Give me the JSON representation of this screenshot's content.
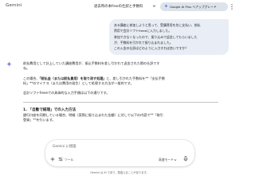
{
  "header": {
    "app_title": "Gemini",
    "chat_title": "退去時の本freeの仕訳と手数料",
    "plus_label": "Google AI Plus へアップグレード",
    "icons": {
      "chevron": "chevron-down-icon",
      "plus": "sparkle-icon",
      "menu": "more-vert-icon"
    }
  },
  "user_message": {
    "lines": [
      "ある講座に参加しようと思って、受講費用を先に支払い、前払",
      "費用で会計ソフトfreeeに入力しました。",
      "参加できなくなったので、振り込みで返金してもらいました",
      "が、手数料を引かれて振り込まれました。",
      "この入金の仕訳はどのように入力すれば良いですか？"
    ]
  },
  "response": {
    "intro": "前払費用として計上していた講座費用が、振込手数料を差し引かれて返金された際の仕訳です",
    "intro_end": "ね。",
    "para2_a": "この場合、",
    "para2_bold": "「前払金（または前払費用）を取り消す処理」",
    "para2_b": "と、差し引かれた手数料を**「支払手数",
    "para2_c": "料」**のマイナス（または費用の発生）として処理する方法が一般的です。",
    "para3": "会計ソフトfreeeでの具体的な入力手順は以下の通りです。",
    "section_heading": "1. 「自動で経理」での入力方法",
    "sec1_a": "銀行口座を同期している場合、明細（実際に振り込まれた金額）に対して以下の内容で**「取引",
    "sec1_b": "登録」**を行います。"
  },
  "input": {
    "placeholder": "Gemini に相談",
    "tools_label": "ツール",
    "mode_label": "高速モード",
    "icons": {
      "add": "plus-icon",
      "tools": "tools-icon",
      "mode": "chevron-down-icon",
      "mic": "mic-icon"
    }
  },
  "footer": {
    "note": "Gemini は AI であり、間違えることがあります。"
  },
  "colors": {
    "user_bubble": "#e9eef6",
    "plus_pill": "#dde3ea",
    "spark_blue": "#4285f4",
    "text": "#1f1f1f"
  }
}
